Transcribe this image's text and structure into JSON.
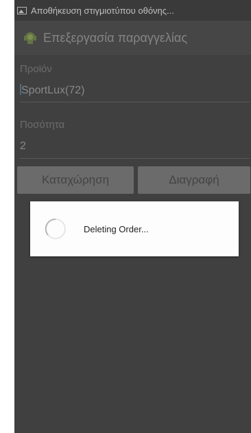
{
  "status_bar": {
    "icon": "screenshot-icon",
    "notification": "Αποθήκευση στιγμιοτύπου οθόνης..."
  },
  "action_bar": {
    "icon": "android-icon",
    "title": "Επεξεργασία παραγγελίας"
  },
  "form": {
    "product_label": "Προϊόν",
    "product_value": "SportLux(72)",
    "quantity_label": "Ποσότητα",
    "quantity_value": "2"
  },
  "buttons": {
    "save": "Καταχώρηση",
    "delete": "Διαγραφή"
  },
  "dialog": {
    "message": "Deleting Order..."
  }
}
